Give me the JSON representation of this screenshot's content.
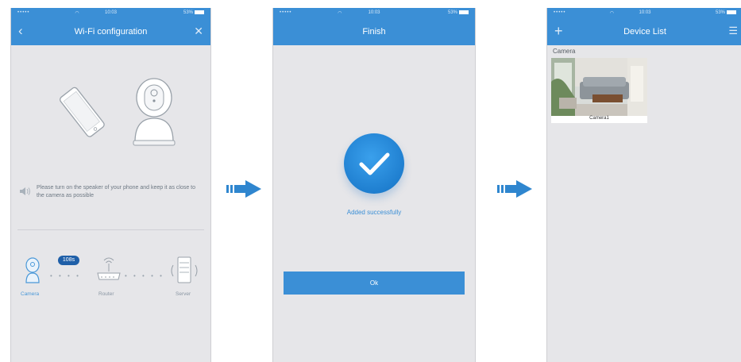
{
  "status_bar": {
    "time": "10:03",
    "battery": "53%"
  },
  "screen1": {
    "title": "Wi-Fi configuration",
    "instruction": "Please turn on the speaker of your phone and keep it as close to the camera as possible",
    "timer": "108s",
    "devices": {
      "camera": "Camera",
      "router": "Router",
      "server": "Server"
    }
  },
  "screen2": {
    "title": "Finish",
    "message": "Added successfully",
    "ok_label": "Ok"
  },
  "screen3": {
    "title": "Device List",
    "section_label": "Camera",
    "camera_name": "Camera1"
  },
  "colors": {
    "header": "#3b8fd6",
    "badge": "#1f5fa8",
    "arrow": "#2f86cf",
    "background": "#e6e6e9"
  }
}
